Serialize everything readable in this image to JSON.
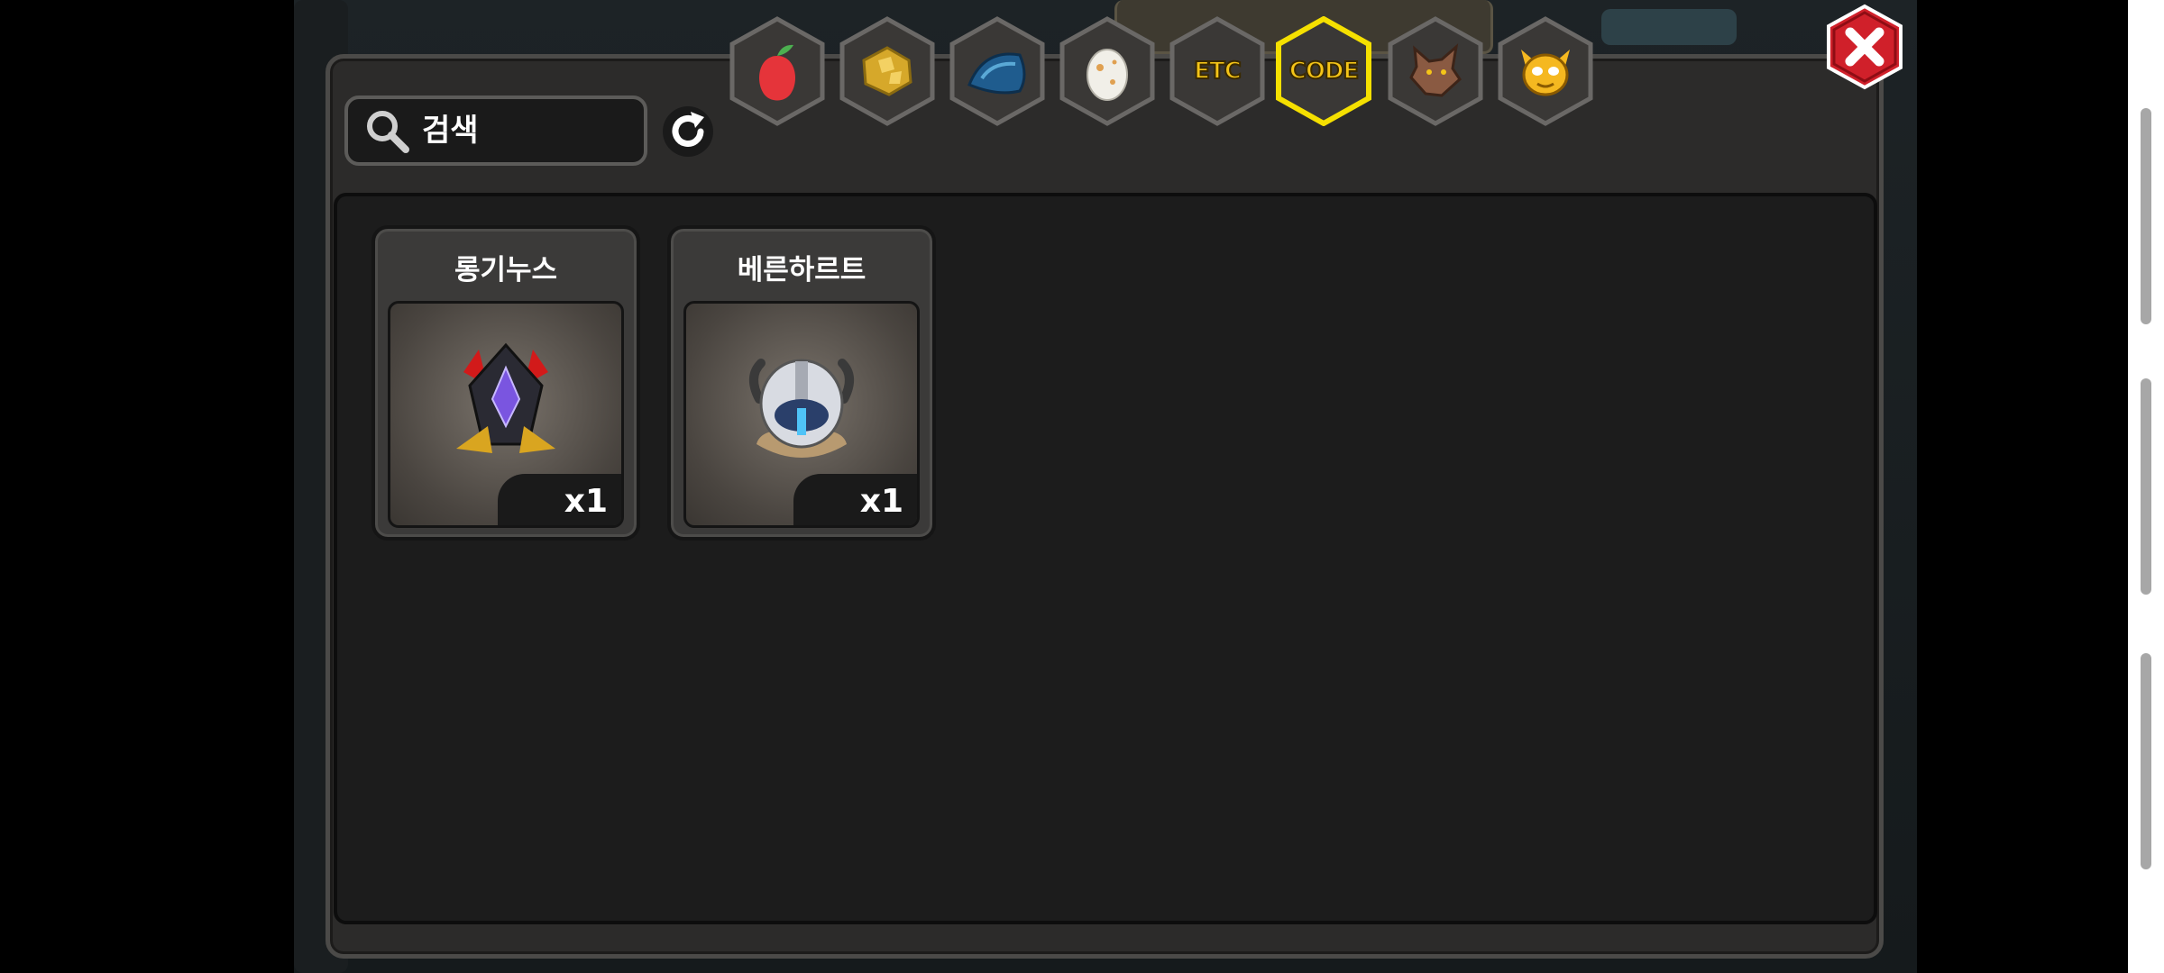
{
  "search": {
    "placeholder": "검색",
    "value": ""
  },
  "tabs": [
    {
      "id": "fruit",
      "icon": "red-fruit-icon",
      "label": "",
      "selected": false
    },
    {
      "id": "ore",
      "icon": "gold-ore-icon",
      "label": "",
      "selected": false
    },
    {
      "id": "scale",
      "icon": "blue-scale-icon",
      "label": "",
      "selected": false
    },
    {
      "id": "egg",
      "icon": "egg-icon",
      "label": "",
      "selected": false
    },
    {
      "id": "etc",
      "icon": "",
      "label": "ETC",
      "selected": false
    },
    {
      "id": "code",
      "icon": "",
      "label": "CODE",
      "selected": true
    },
    {
      "id": "wolf",
      "icon": "wolf-icon",
      "label": "",
      "selected": false
    },
    {
      "id": "monster",
      "icon": "yellow-monster-icon",
      "label": "",
      "selected": false
    }
  ],
  "items": [
    {
      "name": "롱기누스",
      "count": "x1",
      "icon": "dark-crystal-helm-icon"
    },
    {
      "name": "베른하르트",
      "count": "x1",
      "icon": "viking-helmet-icon"
    }
  ],
  "colors": {
    "selected_tab_border": "#f5e000",
    "tab_label": "#f5c518",
    "close_button": "#d0202a",
    "panel_bg": "#2c2b2a",
    "content_bg": "#1c1c1c"
  }
}
